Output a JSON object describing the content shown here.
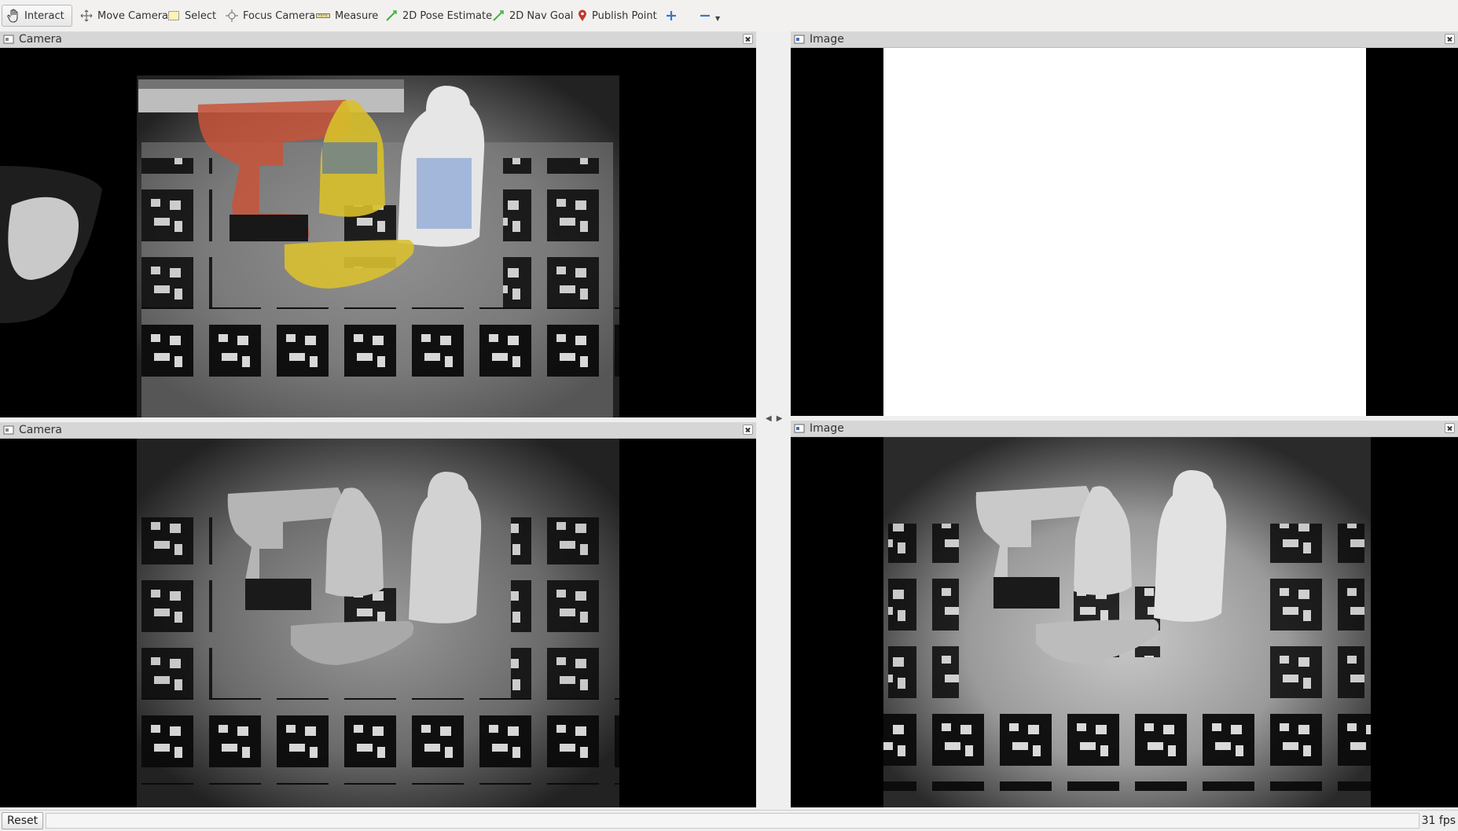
{
  "toolbar": {
    "tools": [
      {
        "label": "Interact",
        "icon": "hand-icon",
        "active": true
      },
      {
        "label": "Move Camera",
        "icon": "move-camera-icon"
      },
      {
        "label": "Select",
        "icon": "select-icon"
      },
      {
        "label": "Focus Camera",
        "icon": "focus-camera-icon"
      },
      {
        "label": "Measure",
        "icon": "ruler-icon"
      },
      {
        "label": "2D Pose Estimate",
        "icon": "green-arrow-icon"
      },
      {
        "label": "2D Nav Goal",
        "icon": "green-arrow-icon"
      },
      {
        "label": "Publish Point",
        "icon": "map-pin-icon"
      }
    ],
    "add_icon": "plus-icon",
    "remove_icon": "minus-icon"
  },
  "panels": {
    "top_left": {
      "title": "Camera",
      "content": "overlay camera view with colored object masks"
    },
    "top_right": {
      "title": "Image",
      "content": "blank white image"
    },
    "bottom_left": {
      "title": "Camera",
      "content": "grayscale camera view"
    },
    "bottom_right": {
      "title": "Image",
      "content": "grayscale image with fiducial markers"
    }
  },
  "status": {
    "reset_label": "Reset",
    "fps": "31 fps"
  },
  "colors": {
    "toolbar_bg": "#f2f1f0",
    "title_bg": "#d6d6d6",
    "drill": "#c8543a",
    "mustard": "#d8c02a",
    "banana": "#d9c030"
  }
}
